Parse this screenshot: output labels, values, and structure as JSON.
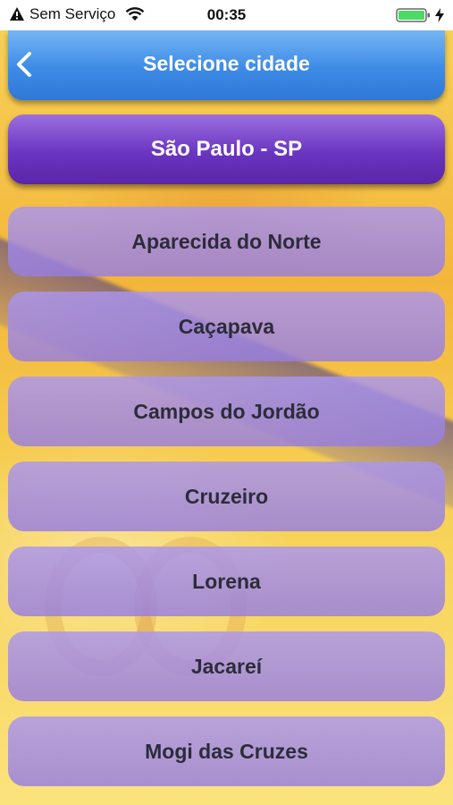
{
  "status_bar": {
    "carrier": "Sem Serviço",
    "time": "00:35"
  },
  "header": {
    "title": "Selecione cidade",
    "back_icon": "chevron-left-icon",
    "color": "#3d8be6"
  },
  "selected_city": {
    "label": "São Paulo - SP",
    "color": "#6a35c0"
  },
  "cities": [
    {
      "label": "Aparecida do Norte"
    },
    {
      "label": "Caçapava"
    },
    {
      "label": "Campos do Jordão"
    },
    {
      "label": "Cruzeiro"
    },
    {
      "label": "Lorena"
    },
    {
      "label": "Jacareí"
    },
    {
      "label": "Mogi das Cruzes"
    }
  ]
}
